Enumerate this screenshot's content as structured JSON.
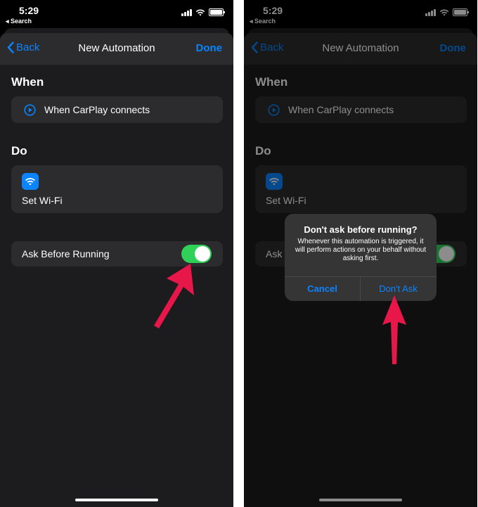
{
  "status": {
    "time": "5:29",
    "back_app": "Search"
  },
  "nav": {
    "back_label": "Back",
    "title": "New Automation",
    "done_label": "Done"
  },
  "when": {
    "heading": "When",
    "trigger_label": "When CarPlay connects"
  },
  "do": {
    "heading": "Do",
    "action_label": "Set Wi-Fi"
  },
  "ask_before_running": {
    "label": "Ask Before Running",
    "label_truncated": "Ask",
    "enabled": true
  },
  "alert": {
    "title": "Don't ask before running?",
    "message": "Whenever this automation is triggered, it will perform actions on your behalf without asking first.",
    "cancel_label": "Cancel",
    "confirm_label": "Don't Ask"
  },
  "colors": {
    "accent": "#0a84ff",
    "toggle_on": "#30d158",
    "arrow": "#e8174a"
  },
  "icons": [
    "chevron-left-icon",
    "play-circle-icon",
    "wifi-icon",
    "cellular-signal-icon",
    "battery-icon"
  ]
}
